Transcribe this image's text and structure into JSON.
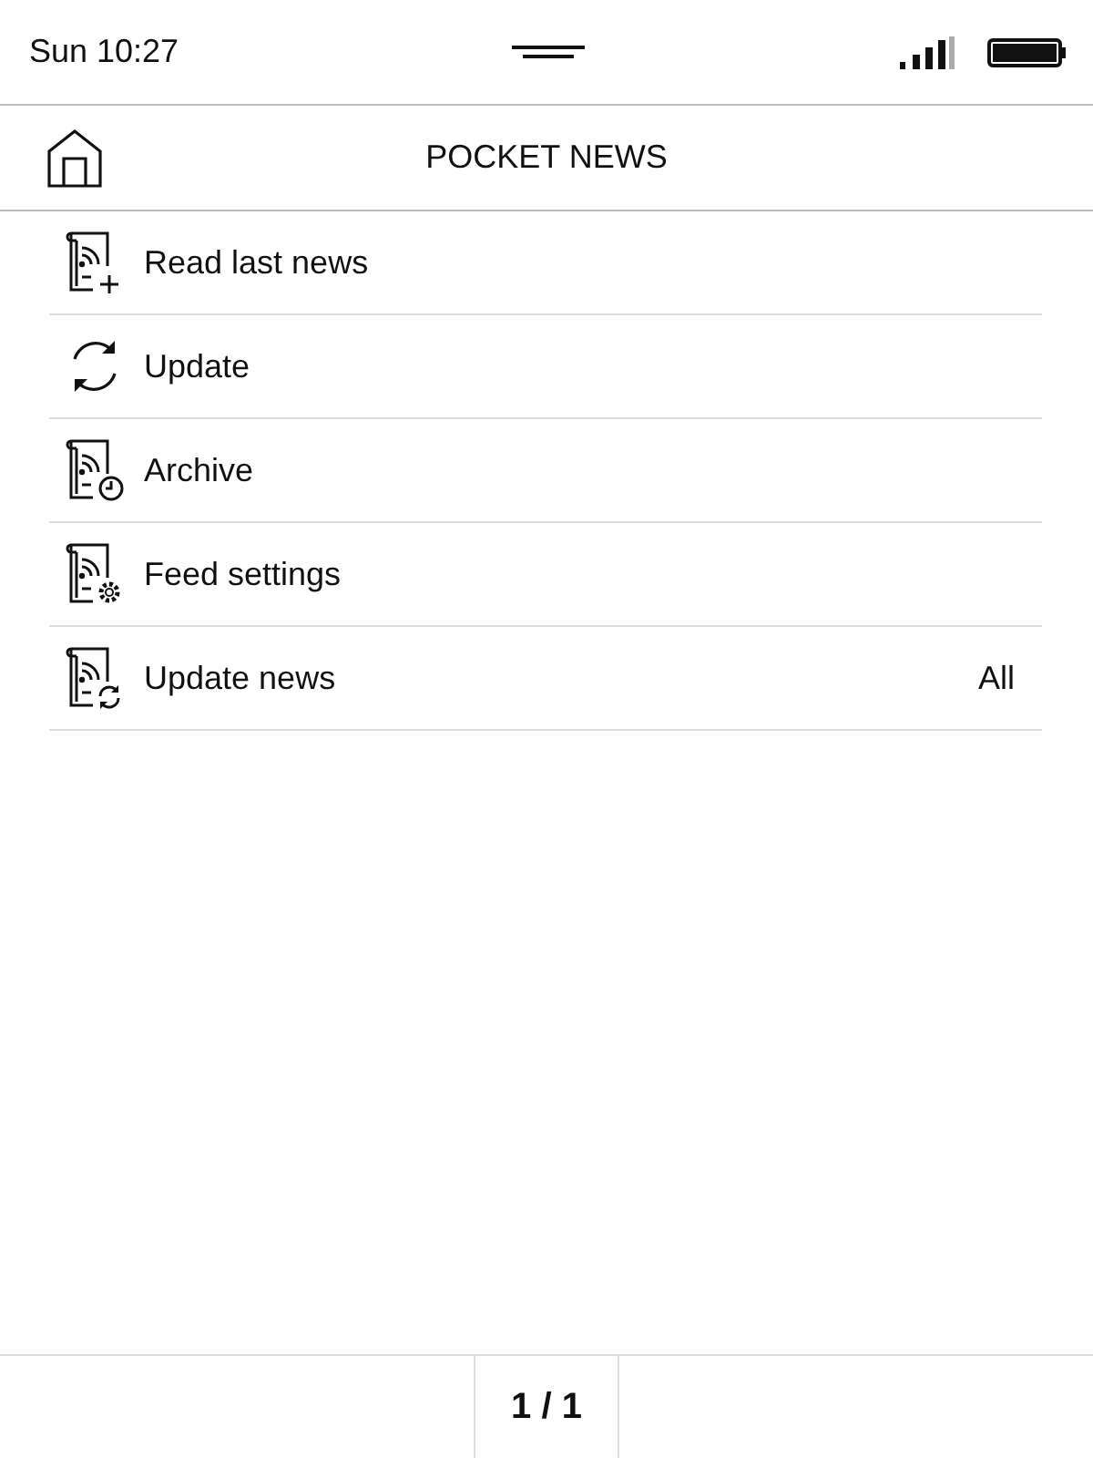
{
  "status_bar": {
    "time": "Sun 10:27"
  },
  "header": {
    "title": "POCKET NEWS"
  },
  "menu": [
    {
      "label": "Read last news",
      "kind": "feed-add"
    },
    {
      "label": "Update",
      "kind": "refresh"
    },
    {
      "label": "Archive",
      "kind": "feed-clock"
    },
    {
      "label": "Feed settings",
      "kind": "feed-gear"
    },
    {
      "label": "Update news",
      "kind": "feed-refresh",
      "value": "All"
    }
  ],
  "pager": {
    "page": "1 / 1"
  }
}
